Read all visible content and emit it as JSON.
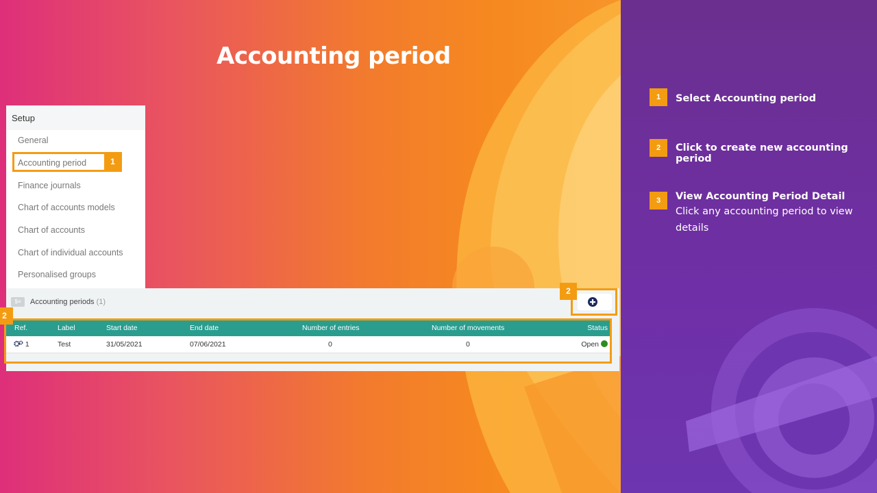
{
  "slide": {
    "title": "Accounting period"
  },
  "setup_menu": {
    "header": "Setup",
    "items": [
      {
        "label": "General"
      },
      {
        "label": "Accounting period"
      },
      {
        "label": "Finance journals"
      },
      {
        "label": "Chart of accounts models"
      },
      {
        "label": "Chart of accounts"
      },
      {
        "label": "Chart of individual accounts"
      },
      {
        "label": "Personalised groups"
      }
    ],
    "callout_number": "1"
  },
  "periods_panel": {
    "title": "Accounting periods",
    "count": "(1)",
    "add_button_icon": "plus-circle-icon",
    "callout_add": "2",
    "callout_table": "2",
    "columns": [
      "Ref.",
      "Label",
      "Start date",
      "End date",
      "Number of entries",
      "Number of movements",
      "Status"
    ],
    "rows": [
      {
        "ref": "1",
        "label": "Test",
        "start_date": "31/05/2021",
        "end_date": "07/06/2021",
        "entries": "0",
        "movements": "0",
        "status": "Open"
      }
    ]
  },
  "instructions": {
    "steps": [
      {
        "number": "1",
        "title": "Select Accounting  period",
        "desc": ""
      },
      {
        "number": "2",
        "title": "Click to create new accounting  period",
        "desc": ""
      },
      {
        "number": "3",
        "title": "View Accounting  Period Detail",
        "desc": "Click any accounting  period to view details"
      }
    ]
  },
  "colors": {
    "accent": "#f39c12",
    "table_header": "#2a9d8f",
    "sidebar": "#6b2f9f",
    "status_open": "#2e8b1f"
  }
}
